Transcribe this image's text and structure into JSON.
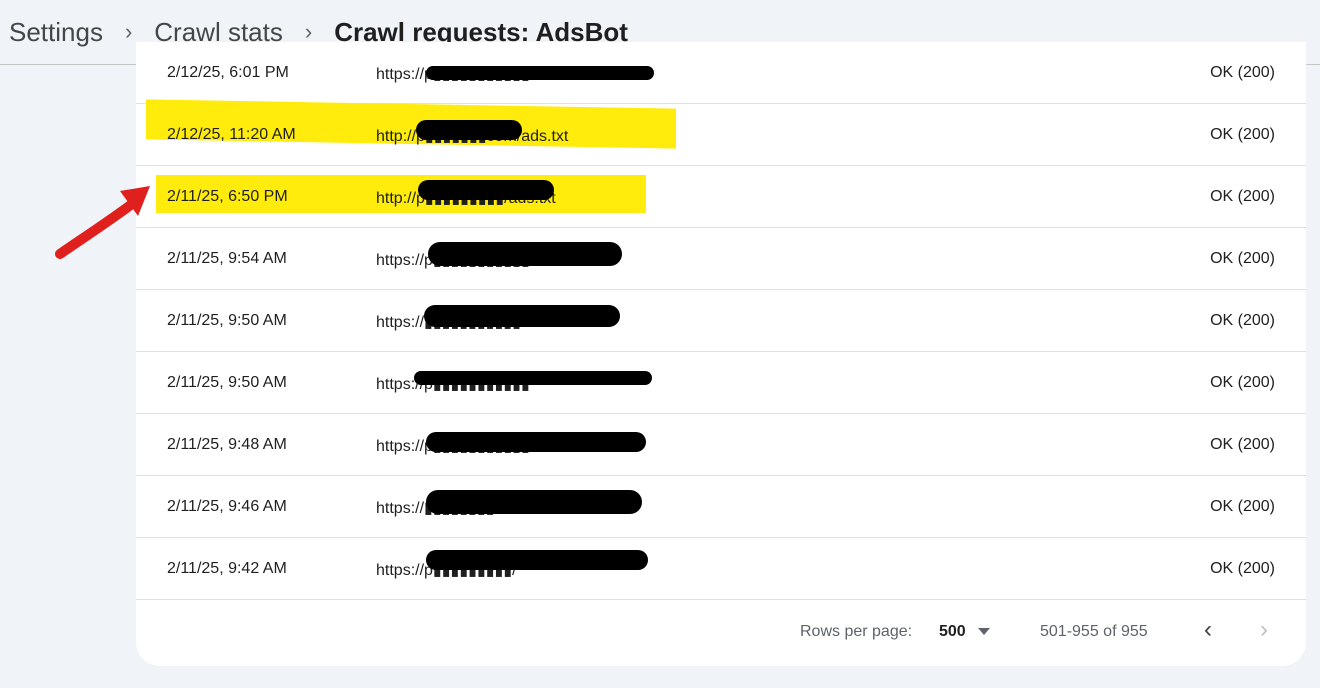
{
  "breadcrumb": {
    "items": [
      "Settings",
      "Crawl stats"
    ],
    "current": "Crawl requests: AdsBot",
    "separator": "›"
  },
  "rows": [
    {
      "date": "2/12/25, 6:01 PM",
      "url": "https://p▮▮▮▮▮▮▮▮▮▮▮",
      "status": "OK (200)"
    },
    {
      "date": "2/12/25, 11:20 AM",
      "url": "http://p▮▮▮▮▮▮▮com/ads.txt",
      "status": "OK (200)"
    },
    {
      "date": "2/11/25, 6:50 PM",
      "url": "http://p▮▮▮▮▮▮▮▮▮/ads.txt",
      "status": "OK (200)"
    },
    {
      "date": "2/11/25, 9:54 AM",
      "url": "https://p▮▮▮▮▮▮▮▮▮▮▮/",
      "status": "OK (200)"
    },
    {
      "date": "2/11/25, 9:50 AM",
      "url": "https://▮▮▮▮▮▮▮▮▮▮▮/",
      "status": "OK (200)"
    },
    {
      "date": "2/11/25, 9:50 AM",
      "url": "https://p▮▮▮▮▮▮▮▮▮▮▮",
      "status": "OK (200)"
    },
    {
      "date": "2/11/25, 9:48 AM",
      "url": "https://p▮▮▮▮▮▮▮▮▮▮▮/",
      "status": "OK (200)"
    },
    {
      "date": "2/11/25, 9:46 AM",
      "url": "https://▮▮▮▮▮▮▮▮.com/ads/",
      "status": "OK (200)"
    },
    {
      "date": "2/11/25, 9:42 AM",
      "url": "https://p▮▮▮▮▮▮▮▮▮/",
      "status": "OK (200)"
    }
  ],
  "pagination": {
    "rows_per_page_label": "Rows per page:",
    "rows_per_page_value": "500",
    "range": "501-955 of 955",
    "prev_icon": "chevron-left-icon",
    "next_icon": "chevron-right-icon"
  },
  "colors": {
    "highlight": "#ffeb00",
    "annotation_arrow": "#e0201c",
    "redaction": "#000000"
  }
}
